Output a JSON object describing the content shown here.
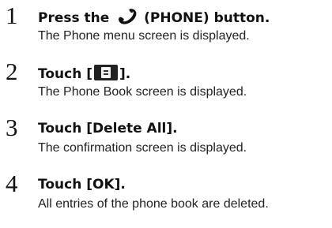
{
  "steps": [
    {
      "number": "1",
      "title_before": "Press the ",
      "title_icon": "phone-handset-icon",
      "title_after": " (PHONE) button.",
      "description": "The Phone menu screen is displayed."
    },
    {
      "number": "2",
      "title_before": "Touch [",
      "title_icon": "phone-book-icon",
      "title_after": "].",
      "description": "The Phone Book screen is displayed."
    },
    {
      "number": "3",
      "title_before": "Touch ",
      "title_strong": "[Delete All]",
      "title_after": ".",
      "description": "The confirmation screen is displayed."
    },
    {
      "number": "4",
      "title_before": "Touch ",
      "title_strong": "[OK]",
      "title_after": ".",
      "description": "All entries of the phone book are deleted."
    }
  ]
}
